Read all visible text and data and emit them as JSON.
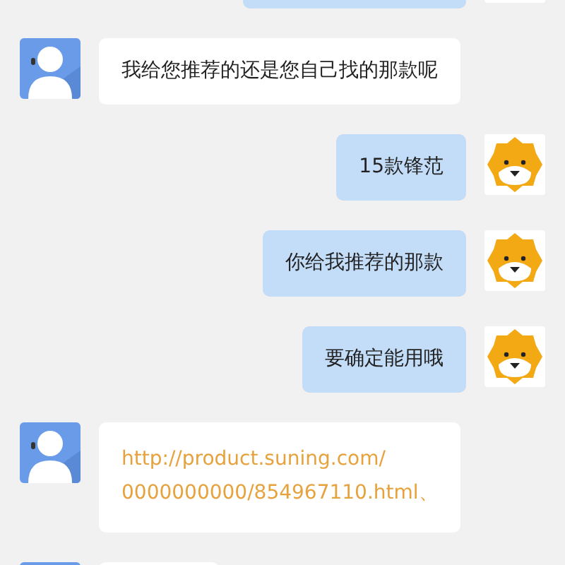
{
  "messages": [
    {
      "outgoing": true,
      "kind": "cut"
    },
    {
      "outgoing": false,
      "kind": "text",
      "text": "我给您推荐的还是您自己找的那款呢"
    },
    {
      "outgoing": true,
      "kind": "text",
      "text": "15款锋范"
    },
    {
      "outgoing": true,
      "kind": "text",
      "text": "你给我推荐的那款"
    },
    {
      "outgoing": true,
      "kind": "text",
      "text": "要确定能用哦"
    },
    {
      "outgoing": false,
      "kind": "link",
      "lines": [
        "http://product.suning.com/",
        "0000000000/854967110.html、"
      ]
    },
    {
      "outgoing": false,
      "kind": "cut"
    }
  ]
}
